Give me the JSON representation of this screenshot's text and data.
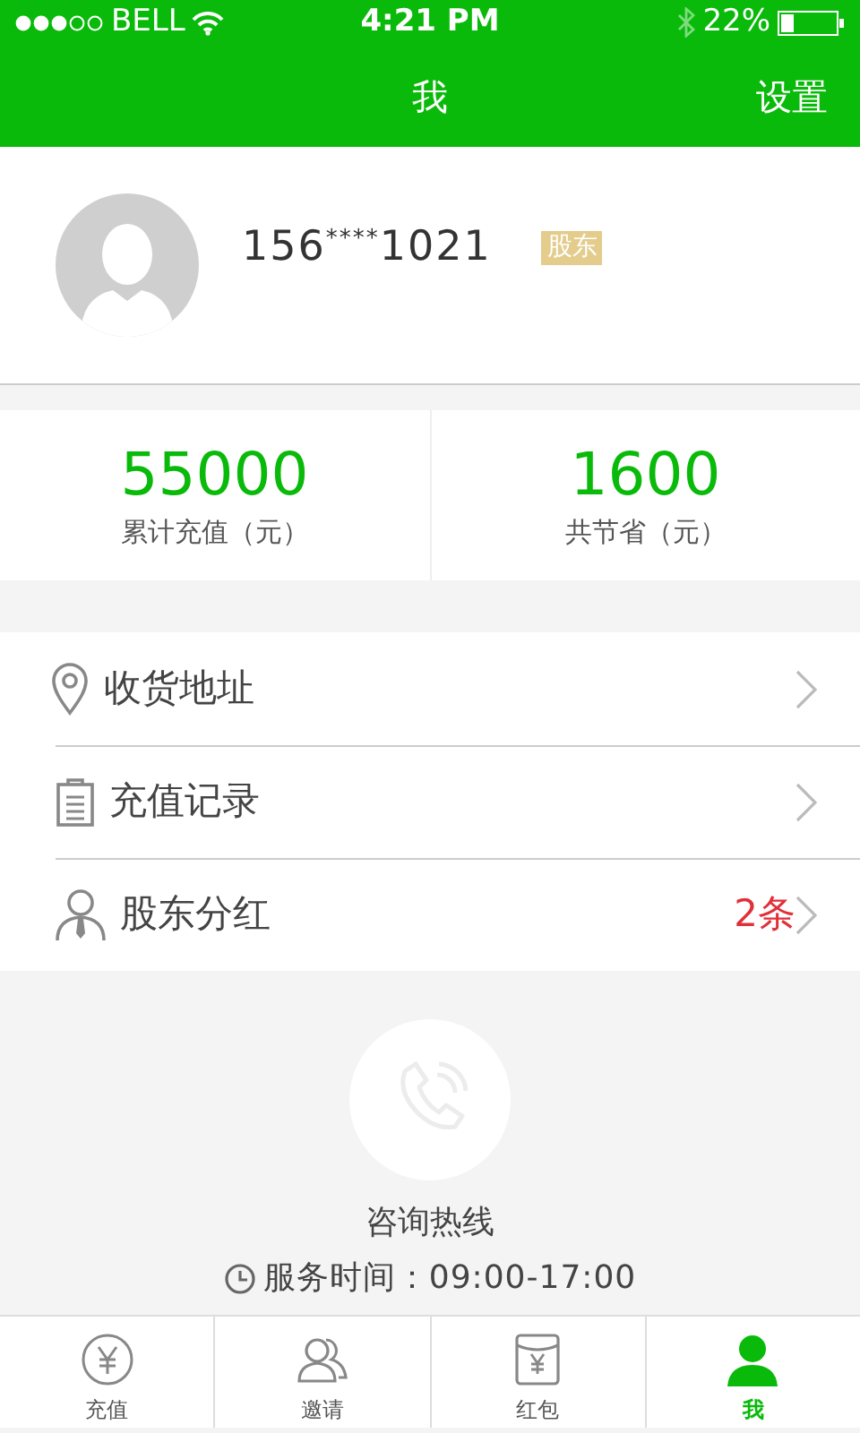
{
  "status_bar": {
    "carrier": "BELL",
    "time": "4:21 PM",
    "battery": "22%"
  },
  "nav": {
    "title": "我",
    "action": "设置"
  },
  "profile": {
    "phone": "156$^{****}$1021",
    "badge": "股东"
  },
  "stats": [
    {
      "value": "55000",
      "label": "累计充值（元）"
    },
    {
      "value": "1600",
      "label": "共节省（元）"
    }
  ],
  "menu": [
    {
      "kind": "pin",
      "label": "收货地址"
    },
    {
      "kind": "clipboard",
      "label": "充值记录"
    },
    {
      "kind": "person",
      "label": "股东分红",
      "count": "2条"
    }
  ],
  "hotline": {
    "title": "咨询热线",
    "hours": "服务时间：09:00-17:00"
  },
  "tabs": [
    {
      "kind": "yuan",
      "label": "充值",
      "selected": false
    },
    {
      "kind": "people",
      "label": "邀请",
      "selected": false
    },
    {
      "kind": "envelope",
      "label": "红包",
      "selected": false
    },
    {
      "kind": "me",
      "label": "我",
      "selected": true
    }
  ]
}
